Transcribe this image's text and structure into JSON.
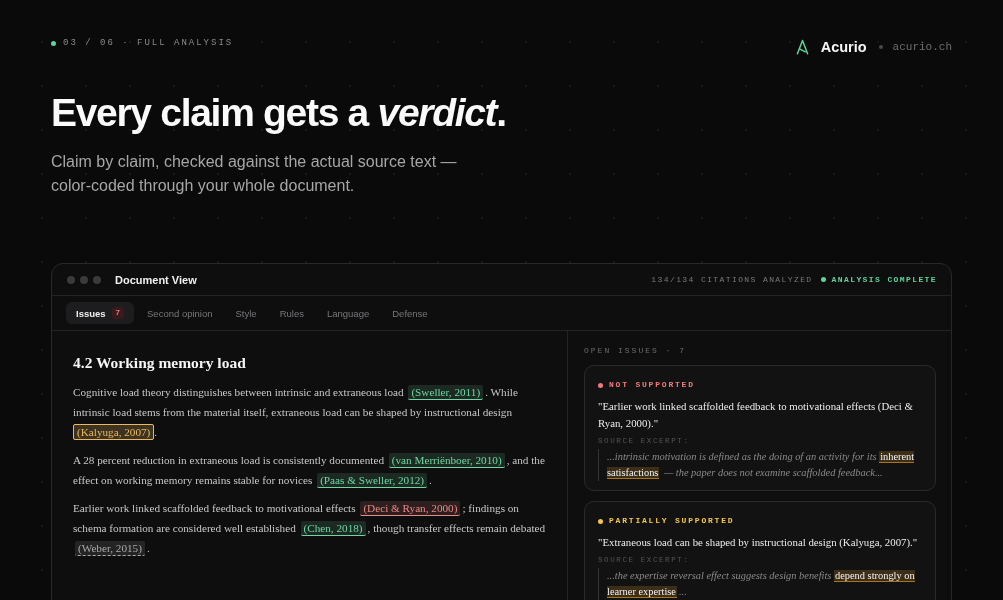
{
  "header": {
    "step": "03 / 06 · FULL ANALYSIS",
    "brand": {
      "name": "Acurio",
      "domain": "acurio.ch"
    }
  },
  "hero": {
    "title": "Every claim gets a *verdict*.",
    "subtitle": "Claim by claim, checked against the actual source text — color-coded through your whole document."
  },
  "window": {
    "title": "Document View",
    "citations_analyzed": "134/134 CITATIONS ANALYZED",
    "analysis_status": "ANALYSIS COMPLETE",
    "tabs": [
      {
        "label": "Issues",
        "badge": "7",
        "selected": true
      },
      {
        "label": "Second opinion",
        "selected": false
      },
      {
        "label": "Style",
        "selected": false
      },
      {
        "label": "Rules",
        "selected": false
      },
      {
        "label": "Language",
        "selected": false
      },
      {
        "label": "Defense",
        "selected": false
      }
    ],
    "document": {
      "heading": "4.2 Working memory load",
      "paragraphs": [
        {
          "segments": [
            {
              "kind": "text",
              "text": "Cognitive load theory distinguishes between intrinsic and extraneous load "
            },
            {
              "kind": "citation",
              "text": "(Sweller, 2011)",
              "color": "#6fd6a0",
              "verified": true,
              "focused": false
            },
            {
              "kind": "text",
              "text": ". While intrinsic load stems from the material itself, extraneous load can be shaped by instructional design "
            },
            {
              "kind": "citation",
              "text": "(Kalyuga, 2007)",
              "color": "#e8b960",
              "verified": true,
              "focused": true
            },
            {
              "kind": "text",
              "text": "."
            }
          ]
        },
        {
          "segments": [
            {
              "kind": "text",
              "text": "A 28 percent reduction in extraneous load is consistently documented "
            },
            {
              "kind": "citation",
              "text": "(van Merriënboer, 2010)",
              "color": "#6fd6a0",
              "verified": true,
              "focused": false
            },
            {
              "kind": "text",
              "text": ", and the effect on working memory remains stable for novices "
            },
            {
              "kind": "citation",
              "text": "(Paas & Sweller, 2012)",
              "color": "#6fd6a0",
              "verified": true,
              "focused": false
            },
            {
              "kind": "text",
              "text": "."
            }
          ]
        },
        {
          "segments": [
            {
              "kind": "text",
              "text": "Earlier work linked scaffolded feedback to motivational effects "
            },
            {
              "kind": "citation",
              "text": "(Deci & Ryan, 2000)",
              "color": "#e98a84",
              "verified": true,
              "focused": false
            },
            {
              "kind": "text",
              "text": "; findings on schema formation are considered well established "
            },
            {
              "kind": "citation",
              "text": "(Chen, 2018)",
              "color": "#6fd6a0",
              "verified": true,
              "focused": false
            },
            {
              "kind": "text",
              "text": ", though transfer effects remain debated "
            },
            {
              "kind": "citation",
              "text": "(Weber, 2015)",
              "color": "#a9a9a9",
              "verified": false,
              "focused": false
            },
            {
              "kind": "text",
              "text": "."
            }
          ]
        }
      ]
    },
    "issues_panel": {
      "title": "OPEN ISSUES · 7",
      "issues": [
        {
          "color": "#f07a7a",
          "label": "NOT SUPPORTED",
          "claim": "\"Earlier work linked scaffolded feedback to motivational effects (Deci & Ryan, 2000).\"",
          "excerpt_label": "SOURCE EXCERPT:",
          "excerpt": [
            {
              "kind": "text",
              "text": "...intrinsic motivation is defined as the doing of an activity for its "
            },
            {
              "kind": "highlight",
              "text": "inherent satisfactions"
            },
            {
              "kind": "text",
              "text": " — the paper does not examine scaffolded feedback..."
            }
          ]
        },
        {
          "color": "#f3c846",
          "label": "PARTIALLY SUPPORTED",
          "claim": "\"Extraneous load can be shaped by instructional design (Kalyuga, 2007).\"",
          "excerpt_label": "SOURCE EXCERPT:",
          "excerpt": [
            {
              "kind": "text",
              "text": "...the expertise reversal effect suggests design benefits "
            },
            {
              "kind": "highlight",
              "text": "depend strongly on learner expertise"
            },
            {
              "kind": "text",
              "text": "..."
            }
          ]
        }
      ]
    }
  }
}
